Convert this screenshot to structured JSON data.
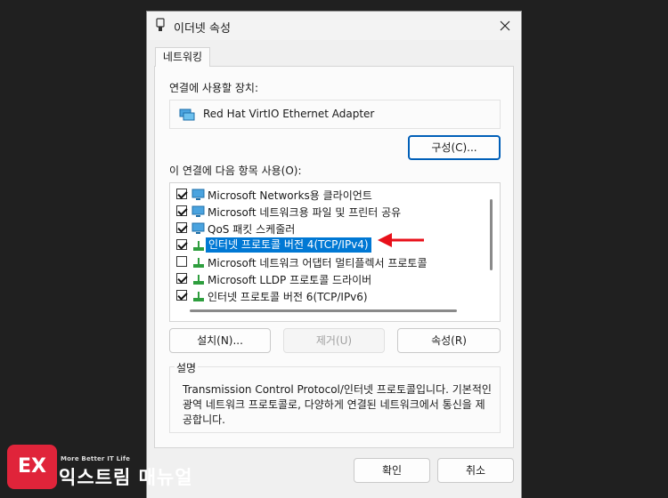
{
  "window": {
    "title": "이더넷 속성",
    "close_icon": "close-icon"
  },
  "tabs": [
    {
      "label": "네트워킹"
    }
  ],
  "connect_using": {
    "label": "연결에 사용할 장치:",
    "adapter": "Red Hat VirtIO Ethernet Adapter",
    "configure_button": "구성(C)..."
  },
  "items_section": {
    "label": "이 연결에 다음 항목 사용(O):",
    "items": [
      {
        "label": "Microsoft Networks용 클라이언트",
        "checked": true,
        "icon": "network-client-icon",
        "selected": false
      },
      {
        "label": "Microsoft 네트워크용 파일 및 프린터 공유",
        "checked": true,
        "icon": "network-client-icon",
        "selected": false
      },
      {
        "label": "QoS 패킷 스케줄러",
        "checked": true,
        "icon": "network-client-icon",
        "selected": false
      },
      {
        "label": "인터넷 프로토콜 버전 4(TCP/IPv4)",
        "checked": true,
        "icon": "protocol-icon",
        "selected": true
      },
      {
        "label": "Microsoft 네트워크 어댑터 멀티플렉서 프로토콜",
        "checked": false,
        "icon": "protocol-icon",
        "selected": false
      },
      {
        "label": "Microsoft LLDP 프로토콜 드라이버",
        "checked": true,
        "icon": "protocol-icon",
        "selected": false
      },
      {
        "label": "인터넷 프로토콜 버전 6(TCP/IPv6)",
        "checked": true,
        "icon": "protocol-icon",
        "selected": false
      }
    ]
  },
  "actions": {
    "install": "설치(N)...",
    "uninstall": "제거(U)",
    "properties": "속성(R)"
  },
  "description": {
    "legend": "설명",
    "text": "Transmission Control Protocol/인터넷 프로토콜입니다. 기본적인 광역 네트워크 프로토콜로, 다양하게 연결된 네트워크에서 통신을 제공합니다."
  },
  "footer": {
    "ok": "확인",
    "cancel": "취소"
  },
  "watermark": {
    "tagline": "More Better IT Life",
    "name": "익스트림 매뉴얼"
  },
  "colors": {
    "selection": "#0078d4",
    "focus_border": "#005fb8",
    "annotation_arrow": "#e8101a"
  }
}
